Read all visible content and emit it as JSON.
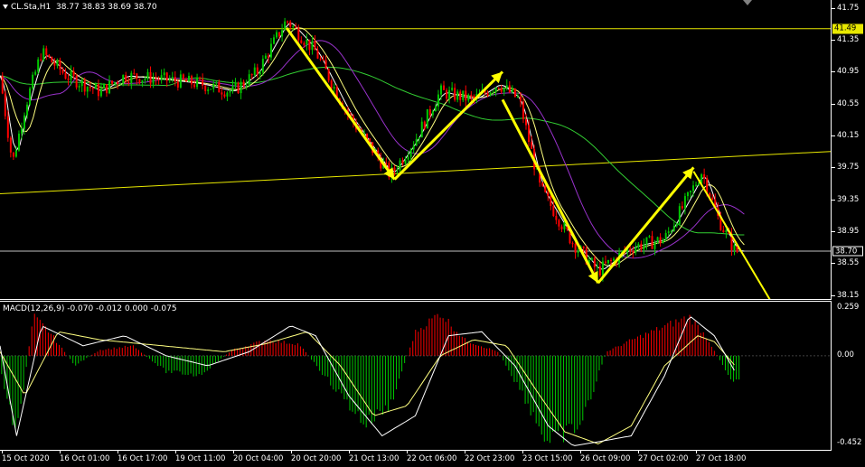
{
  "main": {
    "title": "CL.Sta,H1  38.77 38.83 38.69 38.70",
    "yaxis_labels": [
      "41.75",
      "41.35",
      "40.95",
      "40.55",
      "40.15",
      "39.75",
      "39.35",
      "38.95",
      "38.55",
      "38.15"
    ],
    "price_tags": [
      {
        "label": "41.49",
        "color": "#e8e800",
        "text_color": "#000000"
      },
      {
        "label": "38.70",
        "color": "#000000",
        "text_color": "#ffffff"
      }
    ]
  },
  "macd": {
    "title": "MACD(12,26,9) -0.070 -0.012 0.000 -0.075",
    "yaxis_labels": [
      "0.259",
      "0.00",
      "-0.452"
    ]
  },
  "xaxis_labels": [
    "15 Oct 2020",
    "16 Oct 01:00",
    "16 Oct 17:00",
    "19 Oct 11:00",
    "20 Oct 04:00",
    "20 Oct 20:00",
    "21 Oct 13:00",
    "22 Oct 06:00",
    "22 Oct 23:00",
    "23 Oct 15:00",
    "26 Oct 09:00",
    "27 Oct 02:00",
    "27 Oct 18:00"
  ],
  "colors": {
    "bull": "#00c800",
    "bear": "#ff0000",
    "hline": "#e8e800",
    "trendline": "#e8e800",
    "arrows": "#ffff00",
    "ma_fast": "#ffffff",
    "ma_mid": "#ffff80",
    "ma_purple": "#9932cc",
    "ma_green": "#32cd32",
    "macd_pos": "#ff0000",
    "macd_neg": "#00c800"
  },
  "chart_data": {
    "type": "line",
    "price_range": [
      38.1,
      41.85
    ],
    "macd_range": [
      -0.47,
      0.27
    ],
    "horizontal_levels": [
      41.49,
      38.7
    ],
    "close_path": [
      {
        "t": 0,
        "p": 40.9
      },
      {
        "t": 0.015,
        "p": 39.8
      },
      {
        "t": 0.03,
        "p": 40.5
      },
      {
        "t": 0.05,
        "p": 41.2
      },
      {
        "t": 0.08,
        "p": 40.9
      },
      {
        "t": 0.12,
        "p": 40.7
      },
      {
        "t": 0.15,
        "p": 40.9
      },
      {
        "t": 0.2,
        "p": 40.85
      },
      {
        "t": 0.24,
        "p": 40.8
      },
      {
        "t": 0.28,
        "p": 40.7
      },
      {
        "t": 0.31,
        "p": 40.95
      },
      {
        "t": 0.345,
        "p": 41.6
      },
      {
        "t": 0.38,
        "p": 41.2
      },
      {
        "t": 0.42,
        "p": 40.4
      },
      {
        "t": 0.47,
        "p": 39.65
      },
      {
        "t": 0.5,
        "p": 40.1
      },
      {
        "t": 0.53,
        "p": 40.7
      },
      {
        "t": 0.57,
        "p": 40.6
      },
      {
        "t": 0.6,
        "p": 40.8
      },
      {
        "t": 0.625,
        "p": 40.6
      },
      {
        "t": 0.65,
        "p": 39.5
      },
      {
        "t": 0.69,
        "p": 38.8
      },
      {
        "t": 0.72,
        "p": 38.45
      },
      {
        "t": 0.76,
        "p": 38.75
      },
      {
        "t": 0.8,
        "p": 38.85
      },
      {
        "t": 0.83,
        "p": 39.4
      },
      {
        "t": 0.845,
        "p": 39.7
      },
      {
        "t": 0.865,
        "p": 39.1
      },
      {
        "t": 0.885,
        "p": 38.7
      }
    ],
    "arrows": [
      {
        "from": [
          0.345,
          41.5
        ],
        "to": [
          0.475,
          39.6
        ]
      },
      {
        "from": [
          0.475,
          39.6
        ],
        "to": [
          0.605,
          40.95
        ]
      },
      {
        "from": [
          0.605,
          40.6
        ],
        "to": [
          0.72,
          38.3
        ]
      },
      {
        "from": [
          0.72,
          38.3
        ],
        "to": [
          0.835,
          39.75
        ]
      },
      {
        "from": [
          0.835,
          39.7
        ],
        "to": [
          0.935,
          37.95
        ]
      }
    ],
    "trendline": {
      "from": [
        0.0,
        39.42
      ],
      "to": [
        1.0,
        39.95
      ]
    },
    "macd_hist": [
      {
        "t": 0.0,
        "v": -0.06
      },
      {
        "t": 0.02,
        "v": -0.42
      },
      {
        "t": 0.04,
        "v": 0.2
      },
      {
        "t": 0.06,
        "v": 0.12
      },
      {
        "t": 0.09,
        "v": -0.05
      },
      {
        "t": 0.12,
        "v": 0.03
      },
      {
        "t": 0.16,
        "v": 0.05
      },
      {
        "t": 0.2,
        "v": -0.08
      },
      {
        "t": 0.24,
        "v": -0.1
      },
      {
        "t": 0.28,
        "v": 0.03
      },
      {
        "t": 0.32,
        "v": 0.08
      },
      {
        "t": 0.36,
        "v": 0.06
      },
      {
        "t": 0.4,
        "v": -0.15
      },
      {
        "t": 0.44,
        "v": -0.35
      },
      {
        "t": 0.47,
        "v": -0.25
      },
      {
        "t": 0.5,
        "v": 0.12
      },
      {
        "t": 0.53,
        "v": 0.22
      },
      {
        "t": 0.56,
        "v": 0.08
      },
      {
        "t": 0.6,
        "v": 0.02
      },
      {
        "t": 0.63,
        "v": -0.2
      },
      {
        "t": 0.66,
        "v": -0.45
      },
      {
        "t": 0.7,
        "v": -0.35
      },
      {
        "t": 0.73,
        "v": 0.02
      },
      {
        "t": 0.76,
        "v": 0.08
      },
      {
        "t": 0.8,
        "v": 0.15
      },
      {
        "t": 0.83,
        "v": 0.2
      },
      {
        "t": 0.85,
        "v": 0.1
      },
      {
        "t": 0.88,
        "v": -0.12
      }
    ],
    "macd_line": [
      {
        "t": 0.0,
        "v": 0.05
      },
      {
        "t": 0.02,
        "v": -0.4
      },
      {
        "t": 0.05,
        "v": 0.15
      },
      {
        "t": 0.1,
        "v": 0.05
      },
      {
        "t": 0.15,
        "v": 0.1
      },
      {
        "t": 0.2,
        "v": 0.0
      },
      {
        "t": 0.25,
        "v": -0.05
      },
      {
        "t": 0.3,
        "v": 0.02
      },
      {
        "t": 0.35,
        "v": 0.15
      },
      {
        "t": 0.38,
        "v": 0.1
      },
      {
        "t": 0.42,
        "v": -0.2
      },
      {
        "t": 0.46,
        "v": -0.4
      },
      {
        "t": 0.5,
        "v": -0.3
      },
      {
        "t": 0.54,
        "v": 0.1
      },
      {
        "t": 0.58,
        "v": 0.12
      },
      {
        "t": 0.62,
        "v": -0.05
      },
      {
        "t": 0.66,
        "v": -0.35
      },
      {
        "t": 0.69,
        "v": -0.45
      },
      {
        "t": 0.72,
        "v": -0.43
      },
      {
        "t": 0.76,
        "v": -0.4
      },
      {
        "t": 0.8,
        "v": -0.1
      },
      {
        "t": 0.83,
        "v": 0.2
      },
      {
        "t": 0.86,
        "v": 0.1
      },
      {
        "t": 0.885,
        "v": -0.08
      }
    ],
    "signal_line": [
      {
        "t": 0.0,
        "v": 0.02
      },
      {
        "t": 0.03,
        "v": -0.2
      },
      {
        "t": 0.07,
        "v": 0.12
      },
      {
        "t": 0.12,
        "v": 0.08
      },
      {
        "t": 0.17,
        "v": 0.06
      },
      {
        "t": 0.22,
        "v": 0.04
      },
      {
        "t": 0.27,
        "v": 0.02
      },
      {
        "t": 0.32,
        "v": 0.06
      },
      {
        "t": 0.37,
        "v": 0.12
      },
      {
        "t": 0.41,
        "v": -0.05
      },
      {
        "t": 0.45,
        "v": -0.3
      },
      {
        "t": 0.49,
        "v": -0.25
      },
      {
        "t": 0.53,
        "v": 0.0
      },
      {
        "t": 0.57,
        "v": 0.08
      },
      {
        "t": 0.61,
        "v": 0.05
      },
      {
        "t": 0.65,
        "v": -0.2
      },
      {
        "t": 0.68,
        "v": -0.38
      },
      {
        "t": 0.72,
        "v": -0.44
      },
      {
        "t": 0.76,
        "v": -0.35
      },
      {
        "t": 0.8,
        "v": -0.05
      },
      {
        "t": 0.84,
        "v": 0.1
      },
      {
        "t": 0.86,
        "v": 0.07
      },
      {
        "t": 0.885,
        "v": -0.05
      }
    ]
  }
}
